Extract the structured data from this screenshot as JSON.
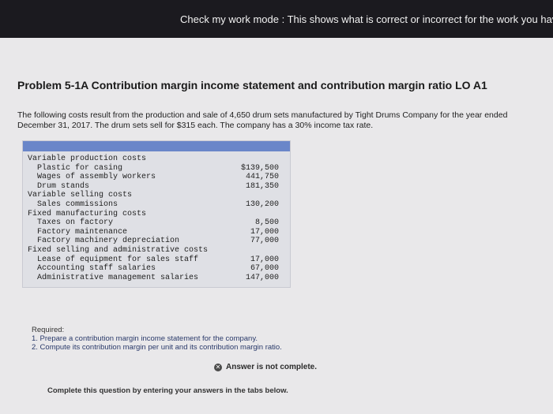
{
  "banner": {
    "text": "Check my work mode : This shows what is correct or incorrect for the work you have complete"
  },
  "problem": {
    "title": "Problem 5-1A Contribution margin income statement and contribution margin ratio LO A1",
    "intro": "The following costs result from the production and sale of 4,650 drum sets manufactured by Tight Drums Company for the year ended December 31, 2017. The drum sets sell for $315 each. The company has a 30% income tax rate."
  },
  "table": {
    "rows": [
      {
        "label": "Variable production costs",
        "amount": "",
        "level": 0
      },
      {
        "label": "Plastic for casing",
        "amount": "$139,500",
        "level": 1
      },
      {
        "label": "Wages of assembly workers",
        "amount": "441,750",
        "level": 1
      },
      {
        "label": "Drum stands",
        "amount": "181,350",
        "level": 1
      },
      {
        "label": "Variable selling costs",
        "amount": "",
        "level": 0
      },
      {
        "label": "Sales commissions",
        "amount": "130,200",
        "level": 1
      },
      {
        "label": "Fixed manufacturing costs",
        "amount": "",
        "level": 0
      },
      {
        "label": "Taxes on factory",
        "amount": "8,500",
        "level": 1
      },
      {
        "label": "Factory maintenance",
        "amount": "17,000",
        "level": 1
      },
      {
        "label": "Factory machinery depreciation",
        "amount": "77,000",
        "level": 1
      },
      {
        "label": "Fixed selling and administrative costs",
        "amount": "",
        "level": 0
      },
      {
        "label": "Lease of equipment for sales staff",
        "amount": "17,000",
        "level": 1
      },
      {
        "label": "Accounting staff salaries",
        "amount": "67,000",
        "level": 1
      },
      {
        "label": "Administrative management salaries",
        "amount": "147,000",
        "level": 1
      }
    ]
  },
  "required": {
    "title": "Required:",
    "items": [
      "1. Prepare a contribution margin income statement for the company.",
      "2. Compute its contribution margin per unit and its contribution margin ratio."
    ]
  },
  "status": {
    "icon": "x-circle-icon",
    "text": "Answer is not complete."
  },
  "instructions": "Complete this question by entering your answers in the tabs below."
}
